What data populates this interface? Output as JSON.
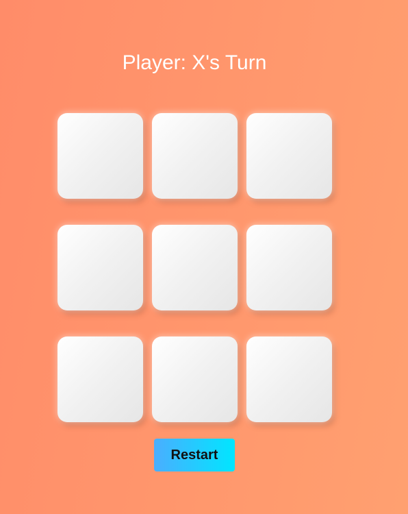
{
  "status": {
    "text": "Player: X's Turn"
  },
  "board": {
    "cells": [
      "",
      "",
      "",
      "",
      "",
      "",
      "",
      "",
      ""
    ]
  },
  "controls": {
    "restart_label": "Restart"
  },
  "colors": {
    "background_start": "#ff8c69",
    "background_end": "#ffa070",
    "cell_light": "#ffffff",
    "cell_dark": "#e6e6e6",
    "button_start": "#4aaeff",
    "button_end": "#00e6ff",
    "status_text": "#ffffff"
  }
}
